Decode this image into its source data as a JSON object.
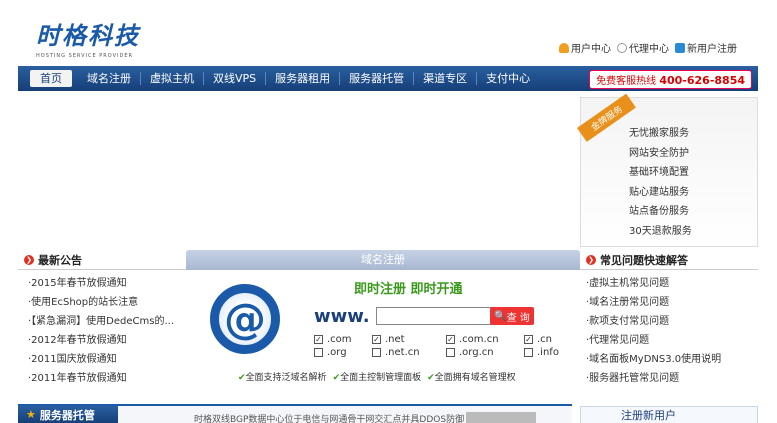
{
  "header": {
    "logo_title": "时格科技",
    "logo_sub": "HOSTING SERVICE PROVIDER",
    "links": [
      "用户中心",
      "代理中心",
      "新用户注册"
    ]
  },
  "nav": {
    "items": [
      "首页",
      "域名注册",
      "虚拟主机",
      "双线VPS",
      "服务器租用",
      "服务器托管",
      "渠道专区",
      "支付中心"
    ],
    "hotline_label": "免费客服热线",
    "hotline_number": "400-626-8854"
  },
  "gold": {
    "ribbon": "金牌服务",
    "items": [
      "无忧搬家服务",
      "网站安全防护",
      "基础环境配置",
      "贴心建站服务",
      "站点备份服务",
      "30天退款服务"
    ]
  },
  "news": {
    "title": "最新公告",
    "items": [
      "·2015年春节放假通知",
      "·使用EcShop的站长注意",
      "·【紧急漏洞】使用DedeCms的...",
      "·2012年春节放假通知",
      "·2011国庆放假通知",
      "·2011年春节放假通知"
    ]
  },
  "domain": {
    "header": "域名注册",
    "slogan": "即时注册  即时开通",
    "www": "www.",
    "input_value": "",
    "search_label": "查 询",
    "tlds": [
      {
        "name": ".com",
        "checked": true
      },
      {
        "name": ".net",
        "checked": true
      },
      {
        "name": ".com.cn",
        "checked": true
      },
      {
        "name": ".cn",
        "checked": true
      },
      {
        "name": ".org",
        "checked": false
      },
      {
        "name": ".net.cn",
        "checked": false
      },
      {
        "name": ".org.cn",
        "checked": false
      },
      {
        "name": ".info",
        "checked": false
      }
    ],
    "features": [
      "全面支持泛域名解析",
      "全面主控制管理面板",
      "全面拥有域名管理权"
    ]
  },
  "faq": {
    "title": "常见问题快速解答",
    "items": [
      "·虚拟主机常见问题",
      "·域名注册常见问题",
      "·款项支付常见问题",
      "·代理常见问题",
      "·域名面板MyDNS3.0使用说明",
      "·服务器托管常见问题"
    ]
  },
  "bottom": {
    "server_tab": "服务器托管",
    "server_text": "时格双线BGP数据中心位于电信与网通骨干网交汇点并具DDOS防御",
    "register_label": "注册新用户"
  }
}
